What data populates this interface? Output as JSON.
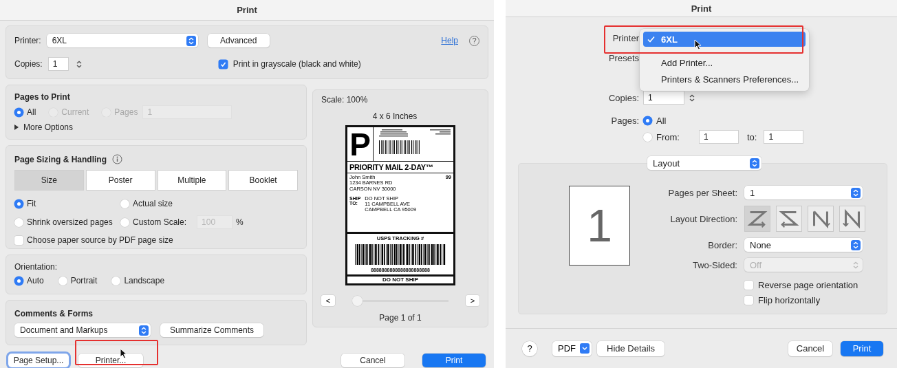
{
  "left_dialog": {
    "title": "Print",
    "printer": {
      "label": "Printer:",
      "value": "6XL"
    },
    "advanced_button": "Advanced",
    "help_link": "Help",
    "help_icon": "?",
    "copies": {
      "label": "Copies:",
      "value": "1"
    },
    "grayscale": {
      "label": "Print in grayscale (black and white)",
      "checked": true
    },
    "pages_to_print": {
      "heading": "Pages to Print",
      "options": [
        {
          "label": "All",
          "selected": true,
          "disabled": false
        },
        {
          "label": "Current",
          "selected": false,
          "disabled": true
        },
        {
          "label": "Pages",
          "selected": false,
          "disabled": true
        }
      ],
      "pages_field": "1",
      "more_options": {
        "label": "More Options",
        "expanded": false
      }
    },
    "page_sizing": {
      "heading": "Page Sizing & Handling",
      "tabs": [
        {
          "label": "Size",
          "selected": true
        },
        {
          "label": "Poster",
          "selected": false
        },
        {
          "label": "Multiple",
          "selected": false
        },
        {
          "label": "Booklet",
          "selected": false
        }
      ],
      "options": [
        {
          "label": "Fit",
          "selected": true
        },
        {
          "label": "Actual size",
          "selected": false
        },
        {
          "label": "Shrink oversized pages",
          "selected": false
        },
        {
          "label": "Custom Scale:",
          "selected": false
        }
      ],
      "custom_scale": "100",
      "percent": "%",
      "paper_source": {
        "label": "Choose paper source by PDF page size",
        "checked": false
      }
    },
    "orientation": {
      "label": "Orientation:",
      "options": [
        {
          "label": "Auto",
          "selected": true
        },
        {
          "label": "Portrait",
          "selected": false
        },
        {
          "label": "Landscape",
          "selected": false
        }
      ]
    },
    "comments_forms": {
      "heading": "Comments & Forms",
      "select": "Document and Markups",
      "button": "Summarize Comments"
    },
    "preview": {
      "scale": "Scale: 100%",
      "size": "4 x 6 Inches",
      "document": {
        "mark": "P",
        "service": "PRIORITY MAIL 2-DAY™",
        "sender": [
          "John Smith",
          "1234 BARNES RD",
          "CARSON NV 30000"
        ],
        "code": "99",
        "ship_to": [
          "SHIP",
          "TO:"
        ],
        "recipient": [
          "DO NOT SHIP",
          "11 CAMPBELL AVE",
          "CAMPBELL CA 95009"
        ],
        "tracking_heading": "USPS TRACKING #",
        "tracking_number": "8888888888888888888888",
        "footer": "DO NOT SHIP"
      },
      "prev": "<",
      "next": ">",
      "slider": {
        "level": 0
      },
      "page": "Page 1 of 1"
    },
    "footer_buttons": [
      {
        "label": "Page Setup...",
        "focused": true
      },
      {
        "label": "Printer...",
        "focused": false
      }
    ],
    "cancel": "Cancel",
    "print": "Print"
  },
  "right_dialog": {
    "title": "Print",
    "printer_label": "Printer",
    "presets_label": "Presets",
    "printer_menu": [
      {
        "label": "6XL",
        "selected": true
      },
      {
        "label": "Add Printer...",
        "selected": false
      },
      {
        "label": "Printers & Scanners Preferences...",
        "selected": false
      }
    ],
    "copies": {
      "label": "Copies:",
      "value": "1"
    },
    "pages": {
      "label": "Pages:",
      "options": [
        {
          "label": "All",
          "selected": true
        },
        {
          "label": "From:",
          "selected": false
        }
      ],
      "from": "1",
      "to_label": "to:",
      "to": "1"
    },
    "section_select": "Layout",
    "layout": {
      "preview_number": "1",
      "pages_per_sheet": {
        "label": "Pages per Sheet:",
        "value": "1"
      },
      "direction": {
        "label": "Layout Direction:",
        "options": [
          {
            "kind": "z",
            "selected": true
          },
          {
            "kind": "reverse-z",
            "selected": false
          },
          {
            "kind": "reverse-n",
            "selected": false
          },
          {
            "kind": "n",
            "selected": false
          }
        ]
      },
      "border": {
        "label": "Border:",
        "value": "None"
      },
      "two_sided": {
        "label": "Two-Sided:",
        "value": "Off",
        "disabled": true
      },
      "checkboxes": [
        {
          "label": "Reverse page orientation",
          "checked": false
        },
        {
          "label": "Flip horizontally",
          "checked": false
        }
      ]
    },
    "help": "?",
    "pdf": "PDF",
    "hide_details": "Hide Details",
    "cancel": "Cancel",
    "print": "Print"
  }
}
